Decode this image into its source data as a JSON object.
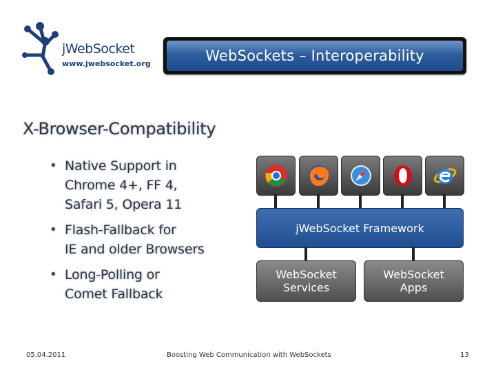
{
  "logo": {
    "name": "jWebSocket",
    "url": "www.jwebsocket.org"
  },
  "title": "WebSockets – Interoperability",
  "heading": "X-Browser-Compatibility",
  "bullets": [
    {
      "lines": [
        "Native Support in",
        "Chrome 4+, FF 4,",
        "Safari 5, Opera 11"
      ]
    },
    {
      "lines": [
        "Flash-Fallback for",
        "IE and older Browsers"
      ]
    },
    {
      "lines": [
        "Long-Polling or",
        "Comet Fallback"
      ]
    }
  ],
  "diagram": {
    "browsers": [
      "chrome-icon",
      "firefox-icon",
      "safari-icon",
      "opera-icon",
      "ie-icon"
    ],
    "framework_label": "jWebSocket Framework",
    "services": {
      "line1": "WebSocket",
      "line2": "Services"
    },
    "apps": {
      "line1": "WebSocket",
      "line2": "Apps"
    }
  },
  "footer": {
    "date": "05.04.2011",
    "center": "Boosting Web Communication with WebSockets",
    "page": "13"
  },
  "colors": {
    "title_bar": "#1d4b8d",
    "framework": "#1f4f92",
    "service_box": "#4f4f4f",
    "logo": "#1f3f7a"
  }
}
